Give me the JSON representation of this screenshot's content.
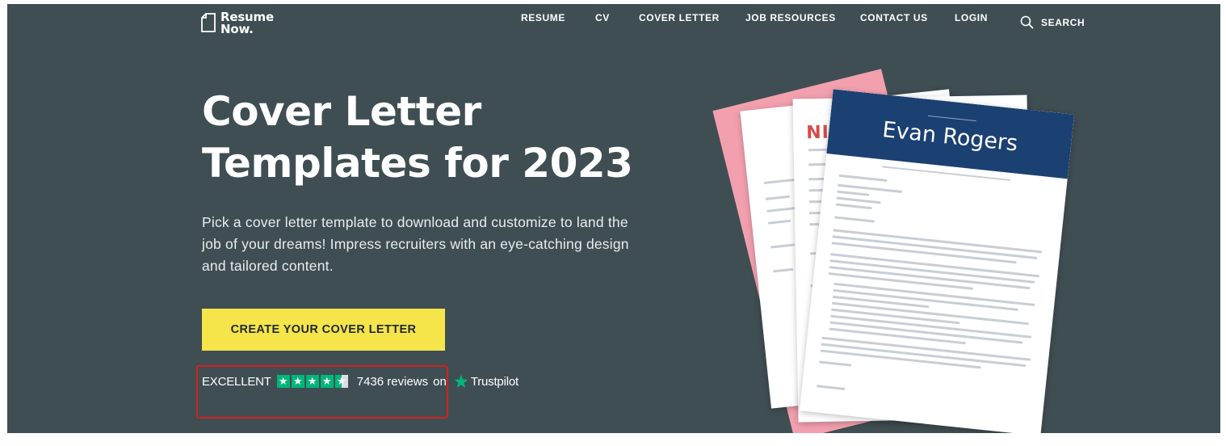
{
  "brand": {
    "logo_line1": "Resume",
    "logo_line2": "Now."
  },
  "nav": {
    "resume": "RESUME",
    "cv": "CV",
    "cover_letter": "COVER LETTER",
    "job_resources": "JOB RESOURCES",
    "contact_us": "CONTACT US",
    "login": "LOGIN",
    "search": "SEARCH"
  },
  "hero": {
    "title_line1": "Cover Letter",
    "title_line2": "Templates for 2023",
    "subtitle": "Pick a cover letter template to download and customize to land the job of your dreams! Impress recruiters with an eye-catching design and tailored content.",
    "cta_label": "CREATE YOUR COVER LETTER"
  },
  "trustpilot": {
    "rating_word": "EXCELLENT",
    "stars": 4.5,
    "reviews": "7436 reviews",
    "on": "on",
    "brand": "Trustpilot"
  },
  "documents": {
    "front_name": "Evan Rogers",
    "back_name_fragment": "NICO"
  },
  "colors": {
    "hero_bg": "#3f4e52",
    "cta_bg": "#f5e44a",
    "trustpilot_green": "#00b67a",
    "highlight_border": "#d42020",
    "doc_header": "#1b4072"
  },
  "icons": {
    "search": "search-icon",
    "logo": "document-icon",
    "star": "star-icon",
    "trustpilot": "trustpilot-star-icon"
  }
}
